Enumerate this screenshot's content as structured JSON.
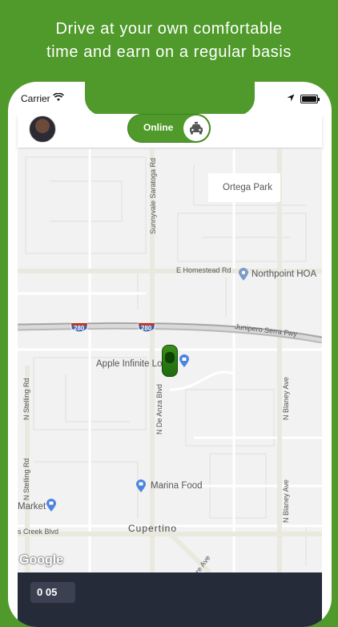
{
  "promo": {
    "line1": "Drive at your own comfortable",
    "line2": "time and  earn on a regular basis"
  },
  "status_bar": {
    "carrier": "Carrier"
  },
  "header": {
    "status_toggle_label": "Online",
    "toggle_icon": "taxi-icon"
  },
  "map": {
    "labels": {
      "ortega_park": "Ortega Park",
      "homestead_rd": "E Homestead Rd",
      "northpoint_hoa": "Northpoint HOA",
      "junipero": "Junipero Serra Fwy",
      "apple": "Apple Infinite Lo",
      "sunnyvale_saratoga": "Sunnyvale Saratoga Rd",
      "de_anza": "N De Anza Blvd",
      "stelling_1": "N Stelling Rd",
      "stelling_2": "N Stelling Rd",
      "blaney_1": "N Blaney Ave",
      "blaney_2": "N Blaney Ave",
      "marina_food": "Marina Food",
      "market": "Market",
      "creek_blvd": "s Creek Blvd",
      "cupertino": "Cupertino",
      "rre_ave": "rre Ave",
      "route_280_a": "280",
      "route_280_b": "280"
    },
    "attribution": "Google"
  },
  "bottom_panel": {
    "chip_text": "0 05"
  },
  "colors": {
    "brand_green": "#4f9a2a",
    "panel_dark": "#262b3a"
  }
}
